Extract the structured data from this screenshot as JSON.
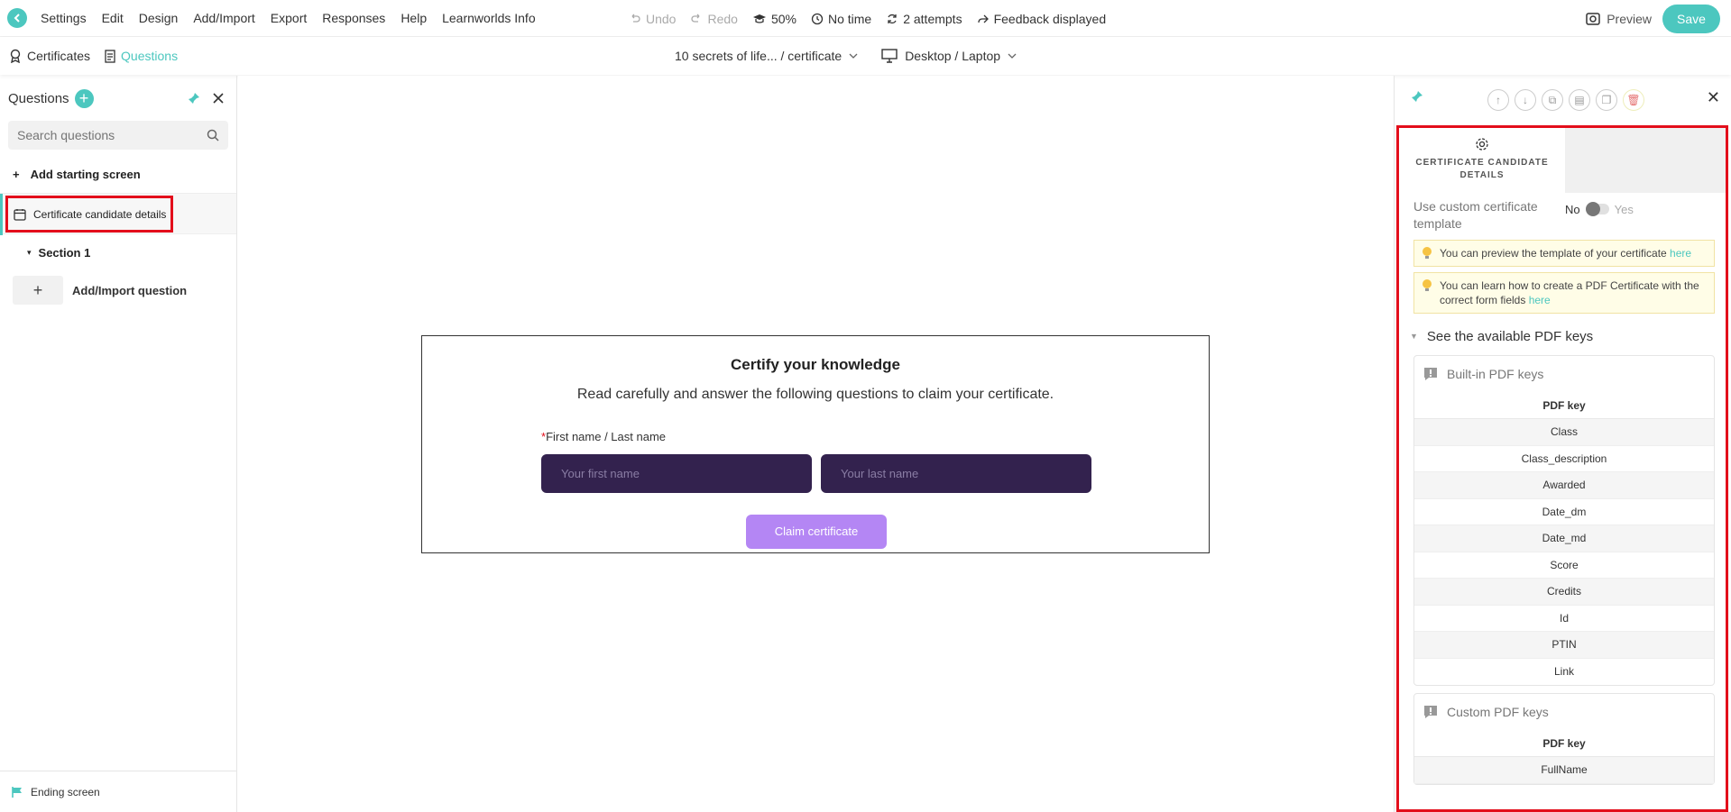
{
  "topbar": {
    "menu": [
      "Settings",
      "Edit",
      "Design",
      "Add/Import",
      "Export",
      "Responses",
      "Help",
      "Learnworlds Info"
    ],
    "undo": "Undo",
    "redo": "Redo",
    "zoom": "50%",
    "time": "No time",
    "attempts": "2 attempts",
    "feedback": "Feedback displayed",
    "preview": "Preview",
    "save": "Save"
  },
  "subbar": {
    "certificates": "Certificates",
    "questions": "Questions",
    "course_path": "10 secrets of life... / certificate",
    "device": "Desktop / Laptop"
  },
  "left_panel": {
    "title": "Questions",
    "search_placeholder": "Search questions",
    "add_starting_screen": "Add starting screen",
    "candidate_details": "Certificate candidate details",
    "section": "Section 1",
    "add_import_question": "Add/Import question",
    "ending_screen": "Ending screen"
  },
  "card": {
    "title": "Certify your knowledge",
    "description": "Read carefully and answer the following questions to claim your certificate.",
    "name_label": "First name / Last name",
    "required_mark": "*",
    "first_name_placeholder": "Your first name",
    "last_name_placeholder": "Your last name",
    "claim_button": "Claim certificate"
  },
  "right_panel": {
    "tab_label": "CERTIFICATE CANDIDATE DETAILS",
    "custom_template_label": "Use custom certificate template",
    "toggle_no": "No",
    "toggle_yes": "Yes",
    "tip1_text": "You can preview the template of your certificate",
    "tip1_link": "here",
    "tip2_text": "You can learn how to create a PDF Certificate with the correct form fields",
    "tip2_link": "here",
    "keys_toggle": "See the available PDF keys",
    "builtin_title": "Built-in PDF keys",
    "builtin_col": "PDF key",
    "builtin_keys": [
      "Class",
      "Class_description",
      "Awarded",
      "Date_dm",
      "Date_md",
      "Score",
      "Credits",
      "Id",
      "PTIN",
      "Link"
    ],
    "custom_title": "Custom PDF keys",
    "custom_col": "PDF key",
    "custom_keys": [
      "FullName"
    ]
  },
  "colors": {
    "accent": "#4cc7bf",
    "highlight": "#e30e1b",
    "input_bg": "#33224e",
    "claim_bg": "#b486f4"
  }
}
